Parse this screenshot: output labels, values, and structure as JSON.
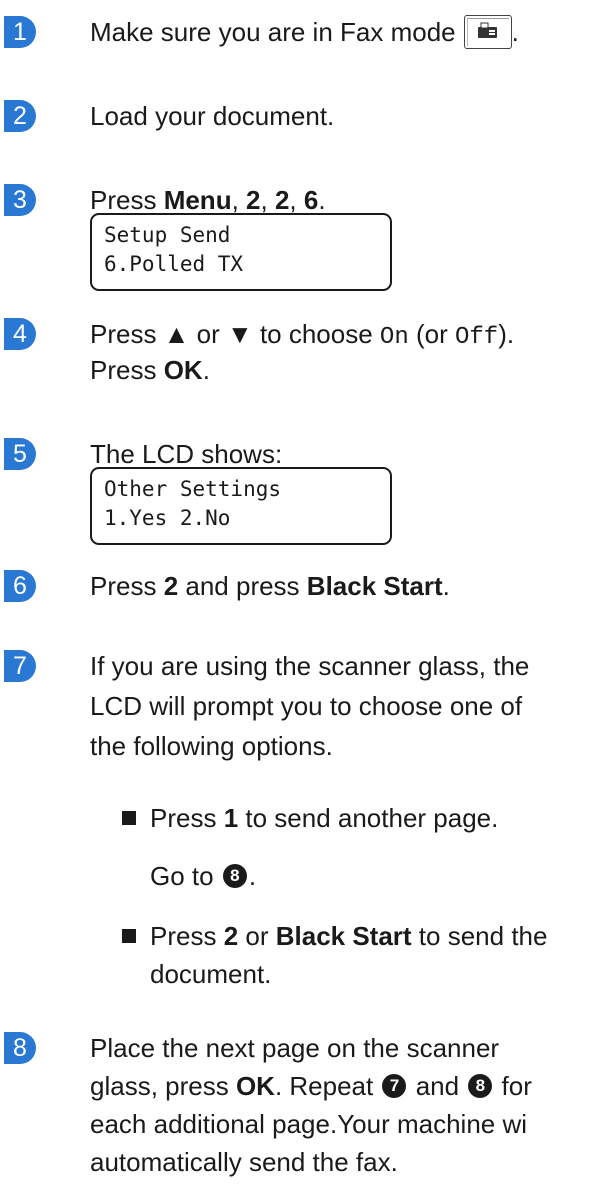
{
  "steps": [
    {
      "num": "1",
      "text": "Make sure you are in Fax mode",
      "trail": "."
    },
    {
      "num": "2",
      "text": "Load your document."
    },
    {
      "num": "3",
      "pre": "Press ",
      "k1": "Menu",
      "s1": ", ",
      "k2": "2",
      "s2": ", ",
      "k3": "2",
      "s3": ", ",
      "k4": "6",
      "post": "."
    },
    {
      "num": "4",
      "l1_a": "Press ▲ or ▼ to choose ",
      "l1_m1": "On",
      "l1_b": " (or ",
      "l1_m2": "Off",
      "l1_c": ").",
      "l2_a": "Press ",
      "l2_k": "OK",
      "l2_b": "."
    },
    {
      "num": "5",
      "text": "The LCD shows:"
    },
    {
      "num": "6",
      "pre": "Press ",
      "k1": "2",
      "mid": " and press ",
      "k2": "Black Start",
      "post": "."
    },
    {
      "num": "7",
      "lines": [
        "If you are using the scanner glass, the",
        "LCD will prompt you to choose one of",
        "the following options."
      ]
    },
    {
      "num": "8",
      "l1": "Place the next page on the scanner",
      "l2_a": "glass, press ",
      "l2_k": "OK",
      "l2_b": ". Repeat ",
      "l2_c1": "7",
      "l2_c": " and ",
      "l2_c2": "8",
      "l2_d": " for",
      "l3": "each additional page.Your machine wi",
      "l4": "automatically send the fax."
    }
  ],
  "lcd1": {
    "line1": "Setup Send",
    "line2": "6.Polled TX"
  },
  "lcd2": {
    "line1": "Other Settings",
    "line2": "1.Yes 2.No"
  },
  "options": [
    {
      "pre": "Press ",
      "key": "1",
      "post": " to send another page.",
      "sub_pre": "Go to ",
      "sub_ref": "8",
      "sub_post": "."
    },
    {
      "pre": "Press ",
      "key": "2",
      "mid": " or ",
      "key2": "Black Start",
      "post": " to send the",
      "line2": "document."
    }
  ],
  "colors": {
    "accent": "#2878d4"
  },
  "icons": {
    "fax_button": "fax-mode-icon"
  }
}
